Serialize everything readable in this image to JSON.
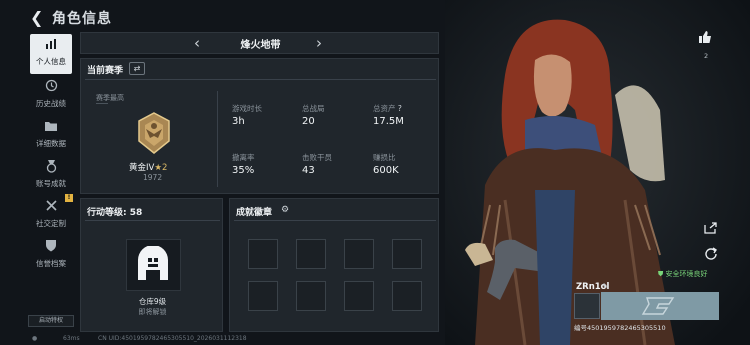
{
  "header": {
    "title": "角色信息",
    "back_icon": "chevron-left"
  },
  "sidebar": {
    "items": [
      {
        "label": "个人信息",
        "icon": "bar-chart",
        "active": true
      },
      {
        "label": "历史战绩",
        "icon": "clock",
        "active": false
      },
      {
        "label": "详细数据",
        "icon": "folder",
        "active": false
      },
      {
        "label": "账号成就",
        "icon": "medal",
        "active": false
      },
      {
        "label": "社交定制",
        "icon": "tools",
        "active": false,
        "badge": "!"
      },
      {
        "label": "信誉档案",
        "icon": "shield",
        "active": false
      }
    ],
    "footer_button": "启动特权"
  },
  "map": {
    "name": "烽火地带"
  },
  "season": {
    "title": "当前赛季",
    "peak_label": "赛季最高",
    "rank_name": "黄金IV",
    "rank_stars": "★2",
    "rank_score": "1972",
    "stats": [
      {
        "label": "游戏时长",
        "value": "3h"
      },
      {
        "label": "总战局",
        "value": "20"
      },
      {
        "label": "总资产",
        "value": "17.5M",
        "help": "?"
      },
      {
        "label": "撤离率",
        "value": "35%"
      },
      {
        "label": "击败干员",
        "value": "43"
      },
      {
        "label": "赚损比",
        "value": "600K"
      }
    ]
  },
  "level": {
    "title": "行动等级: 58",
    "warehouse_name": "仓库9级",
    "warehouse_sub": "即将解锁"
  },
  "medals": {
    "title": "成就徽章",
    "slots": 8
  },
  "right": {
    "like_count": "2",
    "env_status": "安全环境良好",
    "player_name": "ZRn1ol",
    "player_number": "编号4501959782465305510"
  },
  "bottom": {
    "ping": "63ms",
    "uid": "CN UID:4501959782465305510_2026031112318"
  },
  "colors": {
    "accent": "#e9edf0",
    "panel": "#222830",
    "gold": "#c9a35f",
    "plate": "#7f9aa5",
    "env_green": "#7ad67a"
  }
}
